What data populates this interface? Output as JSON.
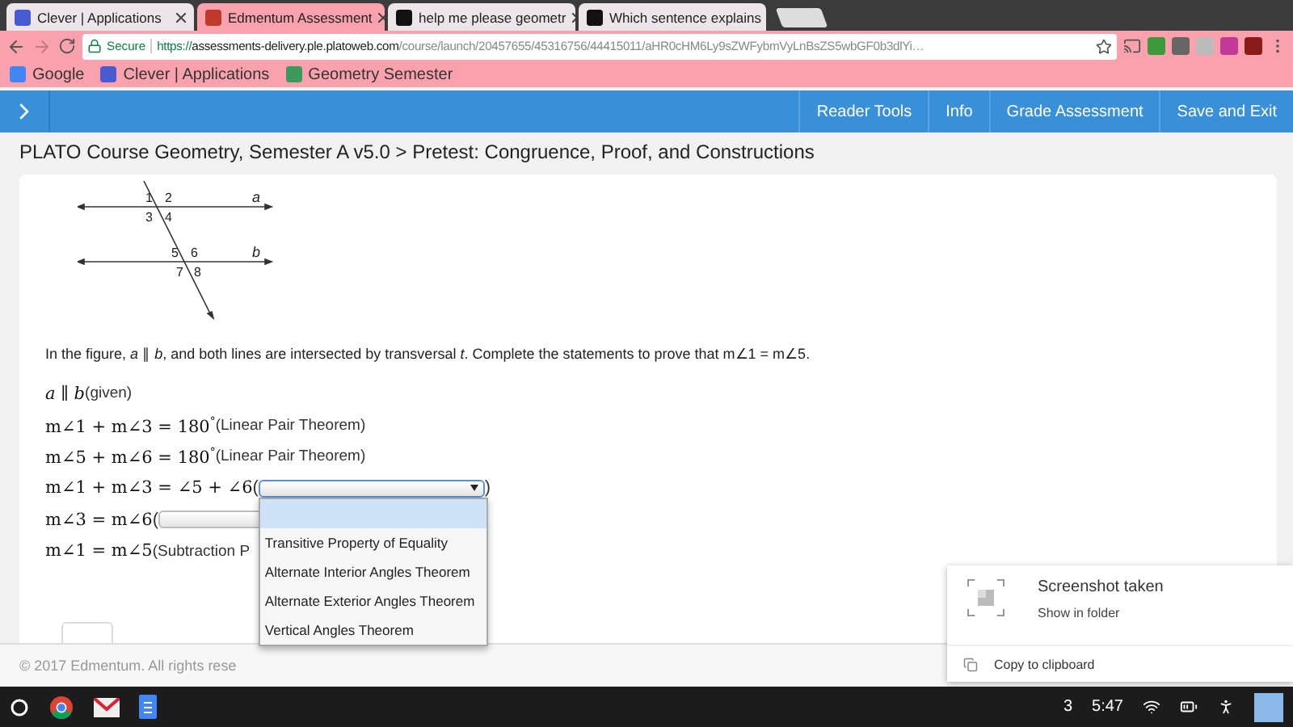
{
  "browser": {
    "tabs": [
      {
        "title": "Clever | Applications",
        "selected": false
      },
      {
        "title": "Edmentum Assessment",
        "selected": true
      },
      {
        "title": "help me please geometr",
        "selected": false
      },
      {
        "title": "Which sentence explains",
        "selected": false
      }
    ],
    "address": {
      "secure_label": "Secure",
      "scheme": "https://",
      "host": "assessments-delivery.ple.platoweb.com",
      "path": "/course/launch/20457655/45316756/44415011/aHR0cHM6Ly9sZWFybmVyLnBsZS5wbGF0b3dlYi…"
    },
    "bookmarks": [
      "Google",
      "Clever | Applications",
      "Geometry Semester"
    ]
  },
  "app_bar": {
    "actions": [
      "Reader Tools",
      "Info",
      "Grade Assessment",
      "Save and Exit"
    ]
  },
  "breadcrumb": "PLATO Course Geometry, Semester A v5.0 > Pretest: Congruence, Proof, and Constructions",
  "figure": {
    "angle_labels": [
      "1",
      "2",
      "3",
      "4",
      "5",
      "6",
      "7",
      "8"
    ],
    "line_labels": [
      "a",
      "b"
    ]
  },
  "prompt": "In the figure, *a* ∥ *b*, and both lines are intersected by transversal *t*. Complete the  statements to prove that m∠1 = m∠5.",
  "statements": [
    {
      "math": "*a* ∥ *b*",
      "reason": {
        "kind": "text",
        "text": "(given)"
      }
    },
    {
      "math": "m∠1 + m∠3 = 180$^{°}$",
      "reason": {
        "kind": "text",
        "text": "(Linear Pair Theorem)"
      }
    },
    {
      "math": "m∠5 + m∠6 = 180$^{°}$",
      "reason": {
        "kind": "text",
        "text": "(Linear Pair Theorem)"
      }
    },
    {
      "math": "m∠1 + m∠3 = ∠5 + ∠6",
      "reason": {
        "kind": "select",
        "open": "(",
        "close": ")",
        "expanded": true,
        "blank_selected": true,
        "options": [
          {
            "label": "Transitive Property of Equality",
            "selected": false
          },
          {
            "label": "Alternate Interior Angles Theorem",
            "selected": false
          },
          {
            "label": "Alternate Exterior Angles Theorem",
            "selected": false
          },
          {
            "label": "Vertical Angles Theorem",
            "selected": false
          }
        ]
      }
    },
    {
      "math": "m∠3 = m∠6",
      "reason": {
        "kind": "select",
        "open": "(",
        "expanded": false
      }
    },
    {
      "math": "m∠1 = m∠5",
      "reason": {
        "kind": "text",
        "text": "(Subtraction P"
      }
    }
  ],
  "footer": "© 2017 Edmentum. All rights rese",
  "notification": {
    "title": "Screenshot taken",
    "link": "Show in folder",
    "action": "Copy to clipboard"
  },
  "shelf": {
    "badge": "3",
    "time": "5:47"
  }
}
